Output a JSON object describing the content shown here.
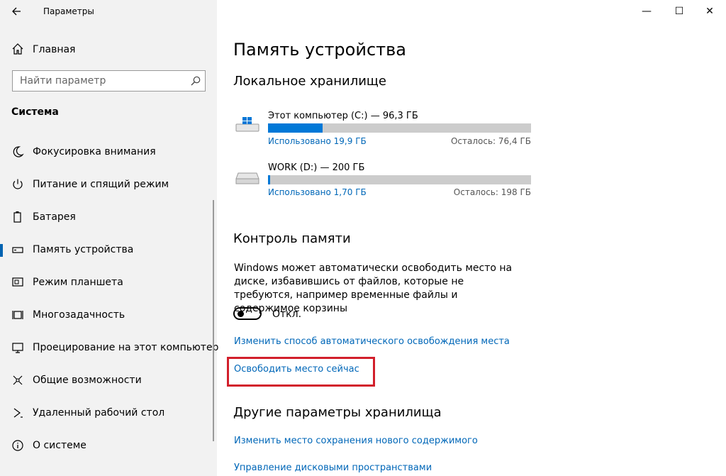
{
  "window": {
    "title": "Параметры",
    "back_icon": "back-arrow-icon",
    "minimize": "—",
    "maximize": "☐",
    "close": "✕"
  },
  "sidebar": {
    "home_label": "Главная",
    "search_placeholder": "Найти параметр",
    "section_title": "Система",
    "items": [
      {
        "label": "Фокусировка внимания",
        "icon": "moon-icon"
      },
      {
        "label": "Питание и спящий режим",
        "icon": "power-icon"
      },
      {
        "label": "Батарея",
        "icon": "battery-icon"
      },
      {
        "label": "Память устройства",
        "icon": "storage-icon",
        "active": true
      },
      {
        "label": "Режим планшета",
        "icon": "tablet-icon"
      },
      {
        "label": "Многозадачность",
        "icon": "multitasking-icon"
      },
      {
        "label": "Проецирование на этот компьютер",
        "icon": "projecting-icon"
      },
      {
        "label": "Общие возможности",
        "icon": "shared-experiences-icon"
      },
      {
        "label": "Удаленный рабочий стол",
        "icon": "remote-desktop-icon"
      },
      {
        "label": "О системе",
        "icon": "info-icon"
      }
    ]
  },
  "main": {
    "title": "Память устройства",
    "local_storage_heading": "Локальное хранилище",
    "drives": [
      {
        "name": "Этот компьютер (C:) — 96,3 ГБ",
        "used": "Использовано 19,9 ГБ",
        "free": "Осталось: 76,4 ГБ",
        "used_fraction": 0.207
      },
      {
        "name": "WORK (D:) — 200 ГБ",
        "used": "Использовано 1,70 ГБ",
        "free": "Осталось: 198 ГБ",
        "used_fraction": 0.0085
      }
    ],
    "storage_sense_heading": "Контроль памяти",
    "storage_sense_desc": "Windows может автоматически освободить место на диске, избавившись от файлов, которые не требуются, например временные файлы и содержимое корзины",
    "toggle_label": "Откл.",
    "link_change_auto": "Изменить способ автоматического освобождения места",
    "link_free_now": "Освободить место сейчас",
    "other_heading": "Другие параметры хранилища",
    "link_change_save_location": "Изменить место сохранения нового содержимого",
    "link_manage_spaces": "Управление дисковыми пространствами"
  },
  "colors": {
    "accent": "#0078d7",
    "link": "#0067b8",
    "highlight_border": "#d21f2b",
    "sidebar_bg": "#f2f2f2"
  }
}
